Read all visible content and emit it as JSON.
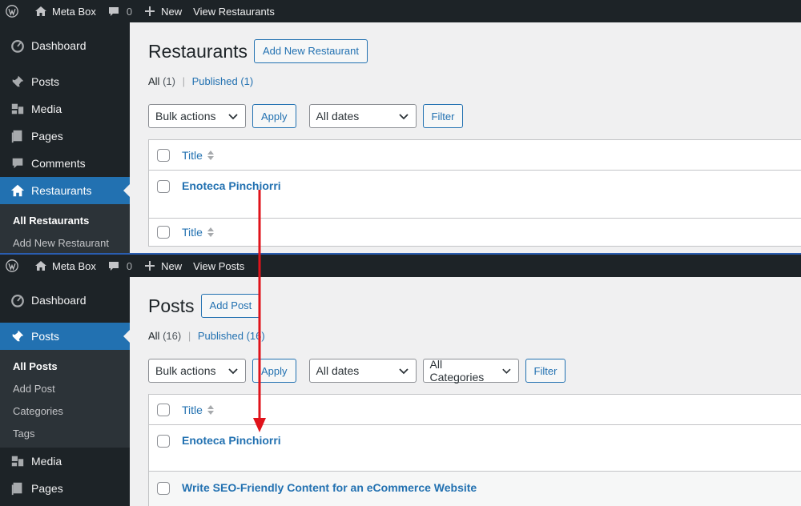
{
  "top": {
    "adminbar": {
      "site_name": "Meta Box",
      "comments_count": "0",
      "new_label": "New",
      "view_label": "View Restaurants"
    },
    "menu": [
      {
        "label": "Dashboard",
        "icon": "dashboard-icon"
      },
      {
        "label": "Posts",
        "icon": "pin-icon"
      },
      {
        "label": "Media",
        "icon": "media-icon"
      },
      {
        "label": "Pages",
        "icon": "pages-icon"
      },
      {
        "label": "Comments",
        "icon": "comments-icon"
      },
      {
        "label": "Restaurants",
        "icon": "home-icon"
      }
    ],
    "submenu": [
      "All Restaurants",
      "Add New Restaurant"
    ],
    "title": "Restaurants",
    "add_new": "Add New Restaurant",
    "views": {
      "all": "All",
      "all_count": "(1)",
      "published": "Published",
      "published_count": "(1)"
    },
    "bulk_actions": "Bulk actions",
    "apply": "Apply",
    "dates": "All dates",
    "filter": "Filter",
    "column_title": "Title",
    "rows": [
      "Enoteca Pinchiorri"
    ]
  },
  "bottom": {
    "adminbar": {
      "site_name": "Meta Box",
      "comments_count": "0",
      "new_label": "New",
      "view_label": "View Posts"
    },
    "menu": [
      {
        "label": "Dashboard",
        "icon": "dashboard-icon"
      },
      {
        "label": "Posts",
        "icon": "pin-icon"
      },
      {
        "label": "Media",
        "icon": "media-icon"
      },
      {
        "label": "Pages",
        "icon": "pages-icon"
      }
    ],
    "submenu": [
      "All Posts",
      "Add Post",
      "Categories",
      "Tags"
    ],
    "title": "Posts",
    "add_new": "Add Post",
    "views": {
      "all": "All",
      "all_count": "(16)",
      "published": "Published",
      "published_count": "(16)"
    },
    "bulk_actions": "Bulk actions",
    "apply": "Apply",
    "dates": "All dates",
    "categories": "All Categories",
    "filter": "Filter",
    "column_title": "Title",
    "rows": [
      "Enoteca Pinchiorri",
      "Write SEO-Friendly Content for an eCommerce Website"
    ]
  },
  "colors": {
    "admin_dark": "#1d2327",
    "accent": "#2271b1",
    "arrow": "#e0131b"
  }
}
